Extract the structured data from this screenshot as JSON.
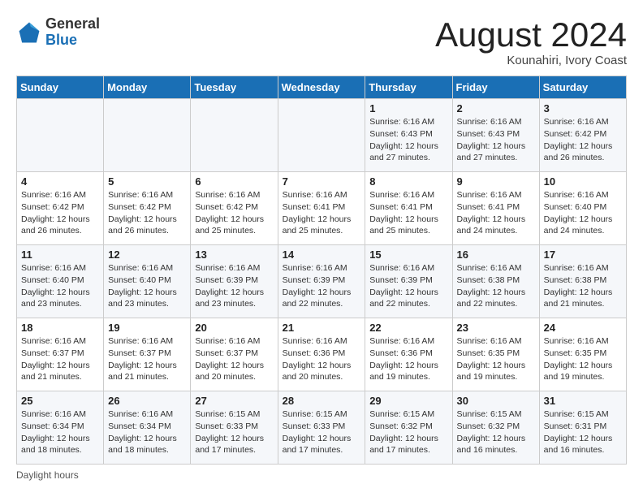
{
  "logo": {
    "general": "General",
    "blue": "Blue"
  },
  "title": "August 2024",
  "subtitle": "Kounahiri, Ivory Coast",
  "days_of_week": [
    "Sunday",
    "Monday",
    "Tuesday",
    "Wednesday",
    "Thursday",
    "Friday",
    "Saturday"
  ],
  "footer": {
    "daylight": "Daylight hours"
  },
  "weeks": [
    [
      {
        "day": "",
        "detail": ""
      },
      {
        "day": "",
        "detail": ""
      },
      {
        "day": "",
        "detail": ""
      },
      {
        "day": "",
        "detail": ""
      },
      {
        "day": "1",
        "detail": "Sunrise: 6:16 AM\nSunset: 6:43 PM\nDaylight: 12 hours\nand 27 minutes."
      },
      {
        "day": "2",
        "detail": "Sunrise: 6:16 AM\nSunset: 6:43 PM\nDaylight: 12 hours\nand 27 minutes."
      },
      {
        "day": "3",
        "detail": "Sunrise: 6:16 AM\nSunset: 6:42 PM\nDaylight: 12 hours\nand 26 minutes."
      }
    ],
    [
      {
        "day": "4",
        "detail": "Sunrise: 6:16 AM\nSunset: 6:42 PM\nDaylight: 12 hours\nand 26 minutes."
      },
      {
        "day": "5",
        "detail": "Sunrise: 6:16 AM\nSunset: 6:42 PM\nDaylight: 12 hours\nand 26 minutes."
      },
      {
        "day": "6",
        "detail": "Sunrise: 6:16 AM\nSunset: 6:42 PM\nDaylight: 12 hours\nand 25 minutes."
      },
      {
        "day": "7",
        "detail": "Sunrise: 6:16 AM\nSunset: 6:41 PM\nDaylight: 12 hours\nand 25 minutes."
      },
      {
        "day": "8",
        "detail": "Sunrise: 6:16 AM\nSunset: 6:41 PM\nDaylight: 12 hours\nand 25 minutes."
      },
      {
        "day": "9",
        "detail": "Sunrise: 6:16 AM\nSunset: 6:41 PM\nDaylight: 12 hours\nand 24 minutes."
      },
      {
        "day": "10",
        "detail": "Sunrise: 6:16 AM\nSunset: 6:40 PM\nDaylight: 12 hours\nand 24 minutes."
      }
    ],
    [
      {
        "day": "11",
        "detail": "Sunrise: 6:16 AM\nSunset: 6:40 PM\nDaylight: 12 hours\nand 23 minutes."
      },
      {
        "day": "12",
        "detail": "Sunrise: 6:16 AM\nSunset: 6:40 PM\nDaylight: 12 hours\nand 23 minutes."
      },
      {
        "day": "13",
        "detail": "Sunrise: 6:16 AM\nSunset: 6:39 PM\nDaylight: 12 hours\nand 23 minutes."
      },
      {
        "day": "14",
        "detail": "Sunrise: 6:16 AM\nSunset: 6:39 PM\nDaylight: 12 hours\nand 22 minutes."
      },
      {
        "day": "15",
        "detail": "Sunrise: 6:16 AM\nSunset: 6:39 PM\nDaylight: 12 hours\nand 22 minutes."
      },
      {
        "day": "16",
        "detail": "Sunrise: 6:16 AM\nSunset: 6:38 PM\nDaylight: 12 hours\nand 22 minutes."
      },
      {
        "day": "17",
        "detail": "Sunrise: 6:16 AM\nSunset: 6:38 PM\nDaylight: 12 hours\nand 21 minutes."
      }
    ],
    [
      {
        "day": "18",
        "detail": "Sunrise: 6:16 AM\nSunset: 6:37 PM\nDaylight: 12 hours\nand 21 minutes."
      },
      {
        "day": "19",
        "detail": "Sunrise: 6:16 AM\nSunset: 6:37 PM\nDaylight: 12 hours\nand 21 minutes."
      },
      {
        "day": "20",
        "detail": "Sunrise: 6:16 AM\nSunset: 6:37 PM\nDaylight: 12 hours\nand 20 minutes."
      },
      {
        "day": "21",
        "detail": "Sunrise: 6:16 AM\nSunset: 6:36 PM\nDaylight: 12 hours\nand 20 minutes."
      },
      {
        "day": "22",
        "detail": "Sunrise: 6:16 AM\nSunset: 6:36 PM\nDaylight: 12 hours\nand 19 minutes."
      },
      {
        "day": "23",
        "detail": "Sunrise: 6:16 AM\nSunset: 6:35 PM\nDaylight: 12 hours\nand 19 minutes."
      },
      {
        "day": "24",
        "detail": "Sunrise: 6:16 AM\nSunset: 6:35 PM\nDaylight: 12 hours\nand 19 minutes."
      }
    ],
    [
      {
        "day": "25",
        "detail": "Sunrise: 6:16 AM\nSunset: 6:34 PM\nDaylight: 12 hours\nand 18 minutes."
      },
      {
        "day": "26",
        "detail": "Sunrise: 6:16 AM\nSunset: 6:34 PM\nDaylight: 12 hours\nand 18 minutes."
      },
      {
        "day": "27",
        "detail": "Sunrise: 6:15 AM\nSunset: 6:33 PM\nDaylight: 12 hours\nand 17 minutes."
      },
      {
        "day": "28",
        "detail": "Sunrise: 6:15 AM\nSunset: 6:33 PM\nDaylight: 12 hours\nand 17 minutes."
      },
      {
        "day": "29",
        "detail": "Sunrise: 6:15 AM\nSunset: 6:32 PM\nDaylight: 12 hours\nand 17 minutes."
      },
      {
        "day": "30",
        "detail": "Sunrise: 6:15 AM\nSunset: 6:32 PM\nDaylight: 12 hours\nand 16 minutes."
      },
      {
        "day": "31",
        "detail": "Sunrise: 6:15 AM\nSunset: 6:31 PM\nDaylight: 12 hours\nand 16 minutes."
      }
    ]
  ]
}
